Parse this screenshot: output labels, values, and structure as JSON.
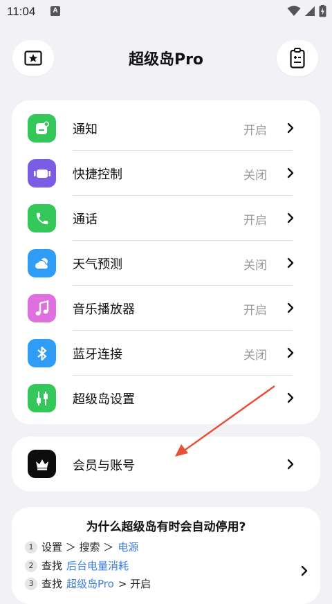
{
  "status_bar": {
    "time": "11:04",
    "notification_glyph": "A"
  },
  "header": {
    "title": "超级岛Pro",
    "left_icon": "star-icon",
    "right_icon": "clipboard-icon"
  },
  "features": [
    {
      "label": "通知",
      "value": "开启",
      "icon": "notification-icon",
      "color": "#34c759"
    },
    {
      "label": "快捷控制",
      "value": "关闭",
      "icon": "quick-control-icon",
      "color": "#7b5ce5"
    },
    {
      "label": "通话",
      "value": "开启",
      "icon": "phone-icon",
      "color": "#34c759"
    },
    {
      "label": "天气预测",
      "value": "关闭",
      "icon": "weather-icon",
      "color": "#2f9cf5"
    },
    {
      "label": "音乐播放器",
      "value": "开启",
      "icon": "music-icon",
      "color": "#e070e0"
    },
    {
      "label": "蓝牙连接",
      "value": "关闭",
      "icon": "bluetooth-icon",
      "color": "#2f9cf5"
    },
    {
      "label": "超级岛设置",
      "value": "",
      "icon": "settings-sliders-icon",
      "color": "#34c759"
    }
  ],
  "membership": {
    "label": "会员与账号",
    "icon": "crown-icon"
  },
  "help": {
    "question": "为什么超级岛有时会自动停用?",
    "steps": [
      {
        "num": "1",
        "prefix": "设置 ＞ 搜索 ＞",
        "highlight": "电源",
        "suffix": ""
      },
      {
        "num": "2",
        "prefix": "查找",
        "highlight": "后台电量消耗",
        "suffix": ""
      },
      {
        "num": "3",
        "prefix": "查找",
        "highlight": "超级岛Pro",
        "suffix": "> 开启"
      }
    ]
  },
  "colors": {
    "background": "#f2f1f6",
    "card": "#ffffff",
    "link": "#3b7de0",
    "annotation_arrow": "#e8503a"
  }
}
